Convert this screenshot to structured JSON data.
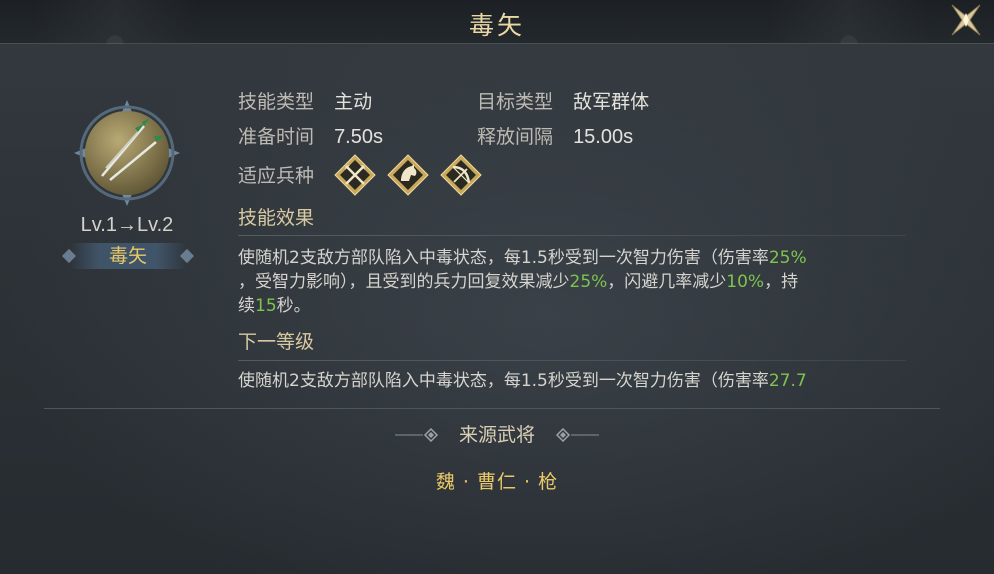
{
  "header": {
    "title": "毒矢",
    "close_icon": "close-x-icon"
  },
  "skill": {
    "icon": "poison-arrows-icon",
    "level": "Lv.1→Lv.2",
    "name": "毒矢"
  },
  "info": {
    "type_label": "技能类型",
    "type_value": "主动",
    "target_label": "目标类型",
    "target_value": "敌军群体",
    "prep_label": "准备时间",
    "prep_value": "7.50s",
    "interval_label": "释放间隔",
    "interval_value": "15.00s",
    "troops_label": "适应兵种",
    "troops": [
      {
        "icon": "crossed-spears-icon",
        "name": "spear"
      },
      {
        "icon": "horse-head-icon",
        "name": "cavalry"
      },
      {
        "icon": "bow-icon",
        "name": "archer"
      }
    ]
  },
  "effect": {
    "title": "技能效果",
    "line1_a": "使随机2支敌方部队陷入中毒状态，每1.5秒受到一次智力伤害（伤害率",
    "line1_g": "25%",
    "line2_a": "，受智力影响），且受到的兵力回复效果减少",
    "line2_g1": "25%",
    "line2_b": "，闪避几率减少",
    "line2_g2": "10%",
    "line2_c": "，持",
    "line3_a": "续",
    "line3_g": "15",
    "line3_b": "秒。"
  },
  "next": {
    "title": "下一等级",
    "line1_a": "使随机2支敌方部队陷入中毒状态，每1.5秒受到一次智力伤害（伤害率",
    "line1_g": "27.7"
  },
  "source": {
    "title": "来源武将",
    "general": "魏 · 曹仁 · 枪"
  },
  "colors": {
    "gold": "#e8c867",
    "green": "#7ec44f",
    "title": "#e9d7a6"
  }
}
